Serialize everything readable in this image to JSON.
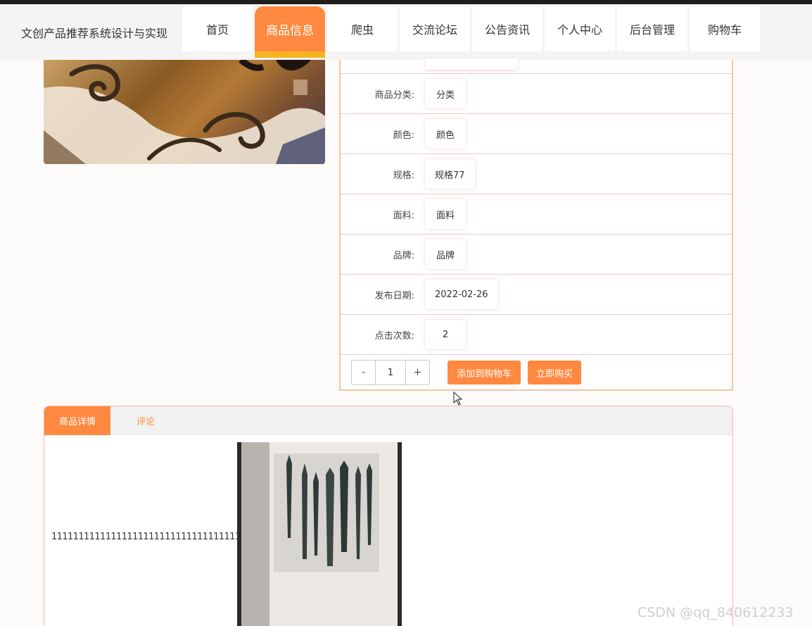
{
  "site": {
    "title": "文创产品推荐系统设计与实现"
  },
  "nav": {
    "items": [
      {
        "label": "首页"
      },
      {
        "label": "商品信息"
      },
      {
        "label": "爬虫"
      },
      {
        "label": "交流论坛"
      },
      {
        "label": "公告资讯"
      },
      {
        "label": "个人中心"
      },
      {
        "label": "后台管理"
      },
      {
        "label": "购物车"
      }
    ],
    "active_index": 1
  },
  "product": {
    "fields": [
      {
        "label": "商品分类:",
        "value": "分类"
      },
      {
        "label": "颜色:",
        "value": "颜色"
      },
      {
        "label": "规格:",
        "value": "规格77"
      },
      {
        "label": "面料:",
        "value": "面料"
      },
      {
        "label": "品牌:",
        "value": "品牌"
      },
      {
        "label": "发布日期:",
        "value": "2022-02-26"
      },
      {
        "label": "点击次数:",
        "value": "2"
      }
    ],
    "quantity": {
      "minus": "-",
      "value": "1",
      "plus": "+"
    },
    "add_to_cart": "添加到购物车",
    "buy_now": "立即购买"
  },
  "tabs": {
    "items": [
      {
        "label": "商品详情"
      },
      {
        "label": "评论"
      }
    ],
    "active_index": 0,
    "detail_text": "1111111111111111111111111111111111111"
  },
  "watermark": "CSDN @qq_840612233",
  "colors": {
    "accent": "#ff8940",
    "active_underline": "#f6b21f",
    "panel_border": "#f3c79d"
  }
}
